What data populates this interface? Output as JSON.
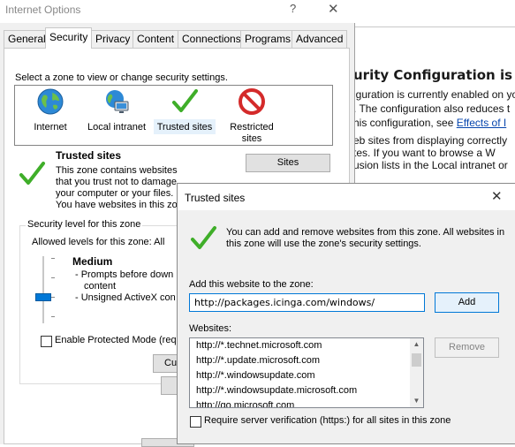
{
  "background_page": {
    "title": "urity Configuration is en",
    "lines": [
      "iguration is currently enabled on your",
      ". The configuration also reduces t",
      "his configuration, see ",
      "eb sites from displaying correctly",
      "tes. If you want to browse a W",
      "usion lists in the Local intranet or"
    ],
    "link_text": "Effects of I"
  },
  "internet_options": {
    "title": "Internet Options",
    "help_glyph": "?",
    "close_glyph": "✕",
    "tabs": [
      "General",
      "Security",
      "Privacy",
      "Content",
      "Connections",
      "Programs",
      "Advanced"
    ],
    "active_tab": "Security",
    "zone_prompt": "Select a zone to view or change security settings.",
    "zones": [
      {
        "label": "Internet",
        "icon": "globe-icon"
      },
      {
        "label": "Local intranet",
        "icon": "intranet-icon"
      },
      {
        "label": "Trusted sites",
        "icon": "check-icon"
      },
      {
        "label": "Restricted sites",
        "icon": "restricted-icon"
      }
    ],
    "selected_zone": "Trusted sites",
    "zone_name": "Trusted sites",
    "zone_description": "This zone contains websites that you trust not to damage your computer or your files.",
    "zone_note": "You have websites in this zon",
    "sites_button": "Sites",
    "security_level_label": "Security level for this zone",
    "allowed_levels": "Allowed levels for this zone: All",
    "level_name": "Medium",
    "level_desc_1": "- Prompts before down",
    "level_desc_2": "content",
    "level_desc_3": "- Unsigned ActiveX con",
    "protected_mode_label": "Enable Protected Mode (requi",
    "protected_mode_checked": false,
    "custom_button": "Cust"
  },
  "trusted_sites": {
    "title": "Trusted sites",
    "close_glyph": "✕",
    "info": "You can add and remove websites from this zone. All websites in this zone will use the zone's security settings.",
    "add_label": "Add this website to the zone:",
    "url_value": "http://packages.icinga.com/windows/",
    "add_button": "Add",
    "websites_label": "Websites:",
    "websites": [
      "http://*.technet.microsoft.com",
      "http://*.update.microsoft.com",
      "http://*.windowsupdate.com",
      "http://*.windowsupdate.microsoft.com",
      "http://go.microsoft.com"
    ],
    "remove_button": "Remove",
    "https_label": "Require server verification (https:) for all sites in this zone",
    "https_checked": false
  },
  "colors": {
    "accent": "#0078d7",
    "check_green": "#3fae29",
    "restricted_red": "#d42a2a"
  }
}
